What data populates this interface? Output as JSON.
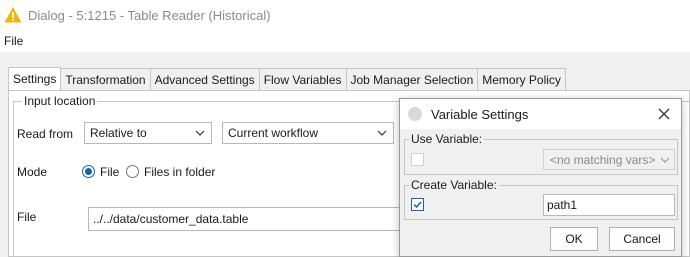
{
  "window": {
    "title": "Dialog - 5:1215 - Table Reader (Historical)"
  },
  "menu": {
    "file": "File"
  },
  "tabs": [
    "Settings",
    "Transformation",
    "Advanced Settings",
    "Flow Variables",
    "Job Manager Selection",
    "Memory Policy"
  ],
  "input_location": {
    "group_title": "Input location",
    "read_from_label": "Read from",
    "read_from_value": "Relative to",
    "relative_value": "Current workflow",
    "mode_label": "Mode",
    "mode_file": "File",
    "mode_files_in_folder": "Files in folder",
    "mode_selected": "File",
    "file_label": "File",
    "file_value": "../../data/customer_data.table"
  },
  "variable_dialog": {
    "title": "Variable Settings",
    "use_variable_title": "Use Variable:",
    "use_variable_value": "<no matching vars>",
    "use_variable_checked": false,
    "create_variable_title": "Create Variable:",
    "create_variable_checked": true,
    "create_variable_name": "path1",
    "ok_label": "OK",
    "cancel_label": "Cancel"
  },
  "colors": {
    "accent": "#1a5fb4",
    "warning": "#f2b705"
  }
}
